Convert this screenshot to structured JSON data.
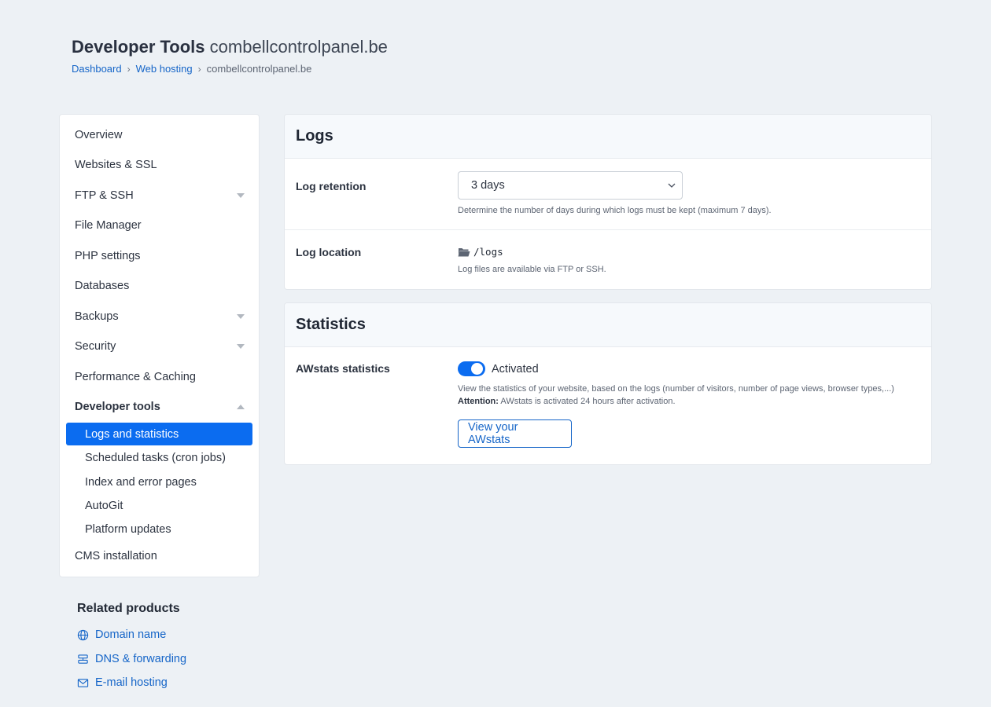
{
  "header": {
    "title": "Developer Tools",
    "domain": "combellcontrolpanel.be",
    "breadcrumb": [
      "Dashboard",
      "Web hosting",
      "combellcontrolpanel.be"
    ],
    "separator": "›"
  },
  "sidebar": {
    "items": [
      {
        "label": "Overview"
      },
      {
        "label": "Websites & SSL"
      },
      {
        "label": "FTP & SSH"
      },
      {
        "label": "File Manager"
      },
      {
        "label": "PHP settings"
      },
      {
        "label": "Databases"
      },
      {
        "label": "Backups"
      },
      {
        "label": "Security"
      },
      {
        "label": "Performance & Caching"
      },
      {
        "label": "Developer tools"
      },
      {
        "label": "CMS installation"
      }
    ],
    "subitems": [
      {
        "label": "Logs and statistics"
      },
      {
        "label": "Scheduled tasks (cron jobs)"
      },
      {
        "label": "Index and error pages"
      },
      {
        "label": "AutoGit"
      },
      {
        "label": "Platform updates"
      }
    ]
  },
  "related": {
    "title": "Related products",
    "links": [
      {
        "label": "Domain name",
        "icon": "globe-icon"
      },
      {
        "label": "DNS & forwarding",
        "icon": "dns-icon"
      },
      {
        "label": "E-mail hosting",
        "icon": "mail-icon"
      }
    ]
  },
  "logs": {
    "title": "Logs",
    "retention_label": "Log retention",
    "retention_value": "3 days",
    "retention_help": "Determine the number of days during which logs must be kept (maximum 7 days).",
    "location_label": "Log location",
    "location_path": "/logs",
    "location_help": "Log files are available via FTP or SSH."
  },
  "statistics": {
    "title": "Statistics",
    "awstats_label": "AWstats statistics",
    "toggle_label": "Activated",
    "help": "View the statistics of your website, based on the logs (number of visitors, number of page views, browser types,...)",
    "attention_label": "Attention:",
    "attention_text": "AWstats is activated 24 hours after activation.",
    "button_label": "View your AWstats"
  },
  "colors": {
    "accent": "#0b6cf0",
    "link": "#1565c8",
    "background": "#edf1f5"
  }
}
